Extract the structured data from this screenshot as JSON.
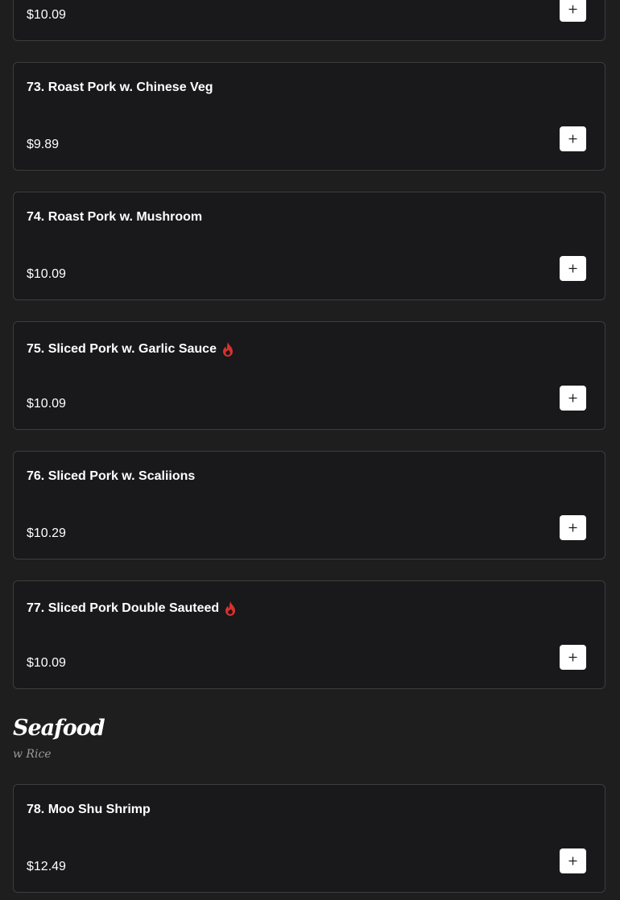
{
  "items": [
    {
      "name": "",
      "price": "$10.09",
      "spicy": false
    },
    {
      "name": "73. Roast Pork w. Chinese Veg",
      "price": "$9.89",
      "spicy": false
    },
    {
      "name": "74. Roast Pork w. Mushroom",
      "price": "$10.09",
      "spicy": false
    },
    {
      "name": "75. Sliced Pork w. Garlic Sauce",
      "price": "$10.09",
      "spicy": true
    },
    {
      "name": "76. Sliced Pork w. Scaliions",
      "price": "$10.29",
      "spicy": false
    },
    {
      "name": "77. Sliced Pork Double Sauteed",
      "price": "$10.09",
      "spicy": true
    }
  ],
  "seafood": {
    "title": "Seafood",
    "subtitle": "w Rice",
    "items": [
      {
        "name": "78. Moo Shu Shrimp",
        "price": "$12.49",
        "spicy": false
      }
    ]
  },
  "icons": {
    "add": "plus-icon",
    "spicy": "flame-icon"
  },
  "colors": {
    "background": "#1e1e1e",
    "card": "#19181a",
    "border": "#3d3d3f",
    "button": "#ffffff",
    "spicy": "#d9322e",
    "subtitle": "#9a9a9a"
  }
}
